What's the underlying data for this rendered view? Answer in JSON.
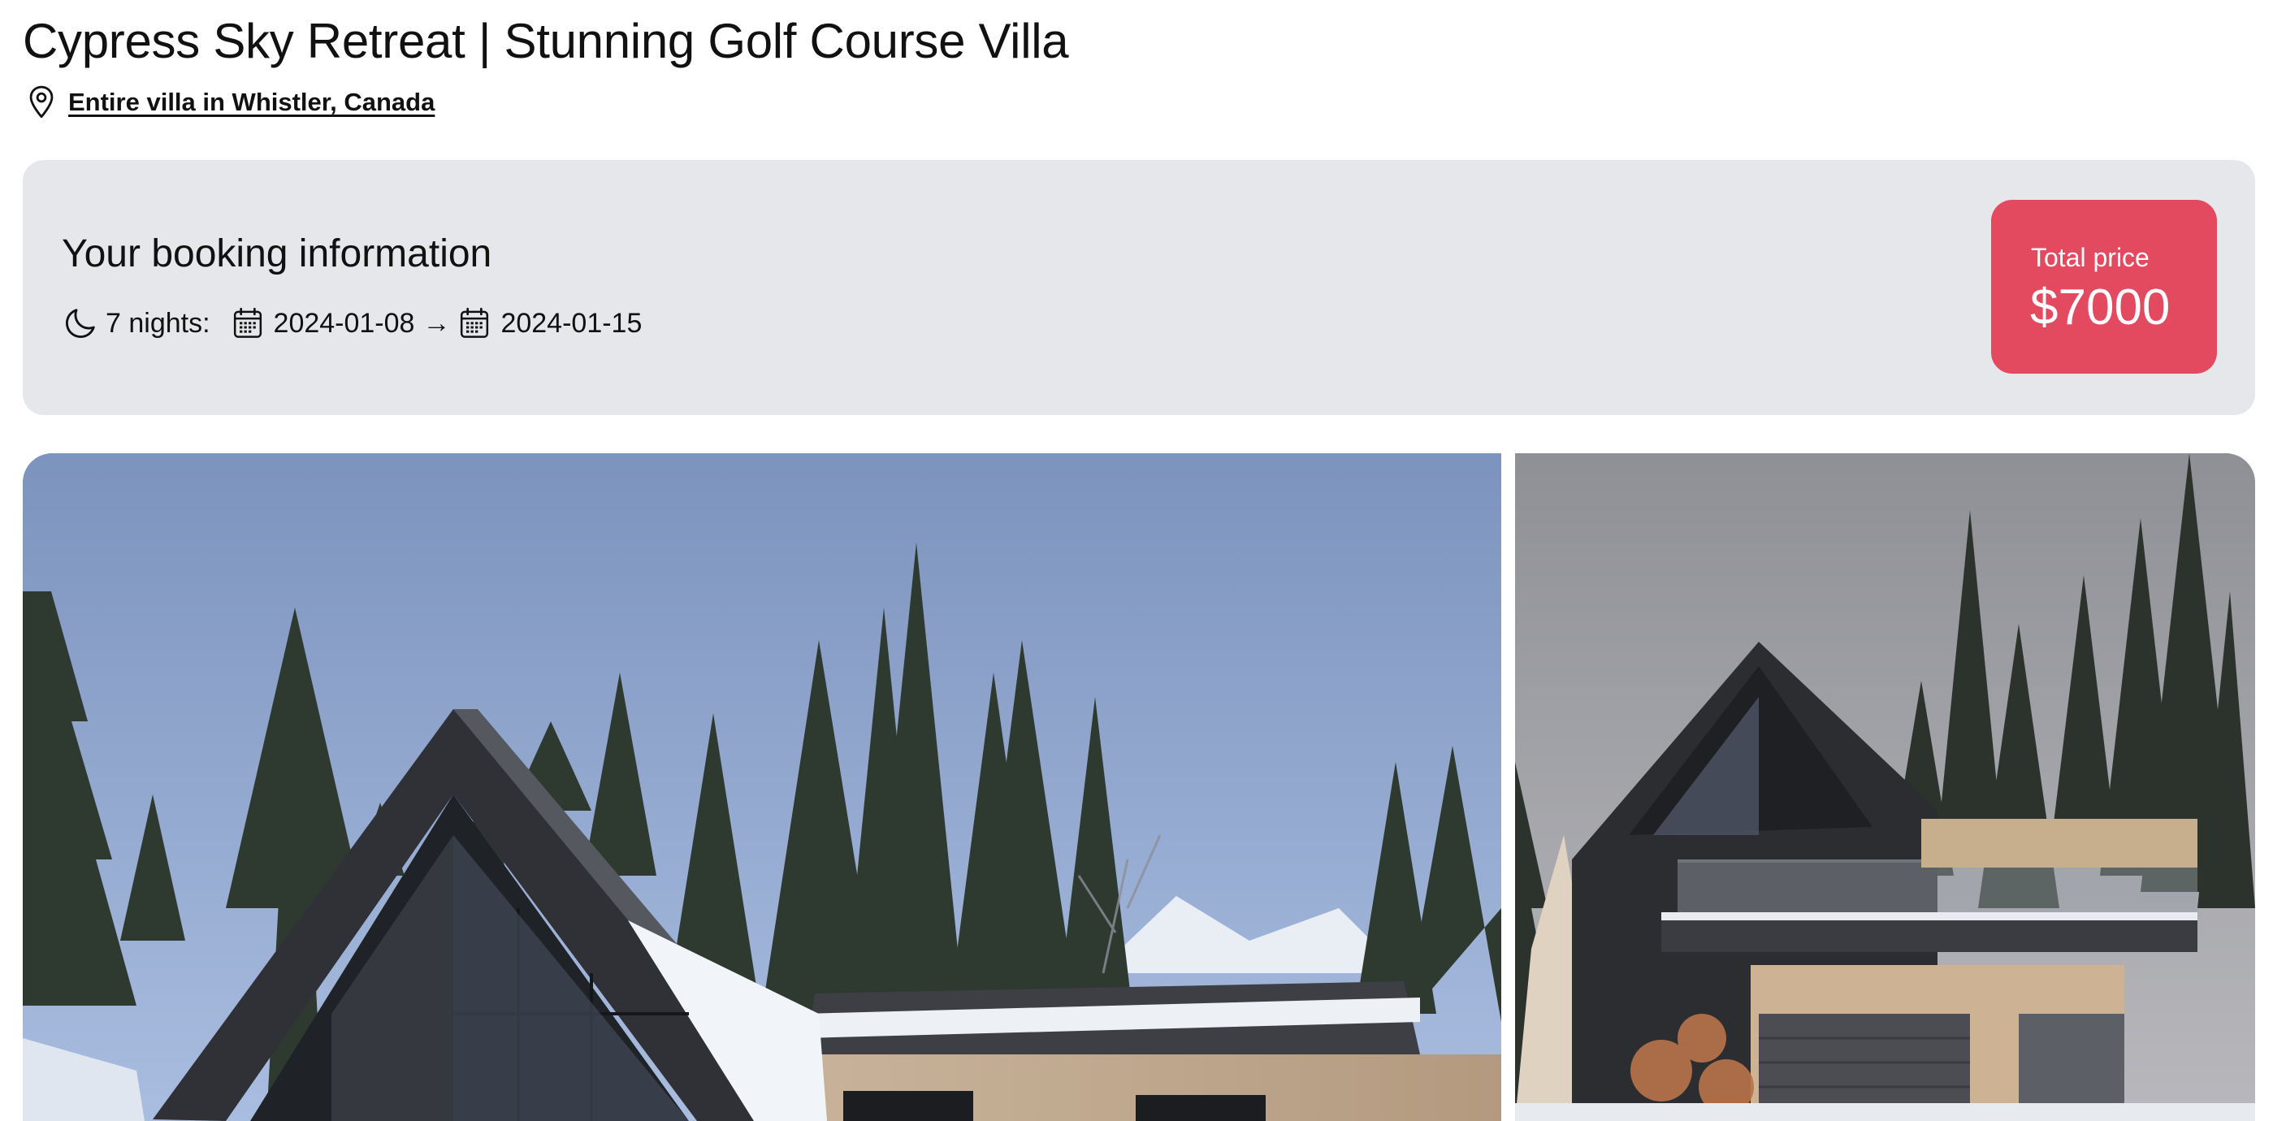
{
  "listing": {
    "title": "Cypress Sky Retreat | Stunning Golf Course Villa",
    "location_text": "Entire villa in Whistler, Canada",
    "icons": {
      "location": "map-pin-icon"
    }
  },
  "booking": {
    "heading": "Your booking information",
    "nights_label": "7 nights:",
    "check_in": "2024-01-08",
    "arrow": "→",
    "check_out": "2024-01-15",
    "icons": {
      "nights": "moon-icon",
      "date": "calendar-icon"
    },
    "total_label": "Total price",
    "total_value": "$7000",
    "total_color": "#e34a5f",
    "panel_color": "#e6e7eb"
  },
  "gallery": {
    "photos": [
      {
        "name": "villa-exterior-photo-main"
      },
      {
        "name": "villa-exterior-photo-side"
      }
    ]
  }
}
